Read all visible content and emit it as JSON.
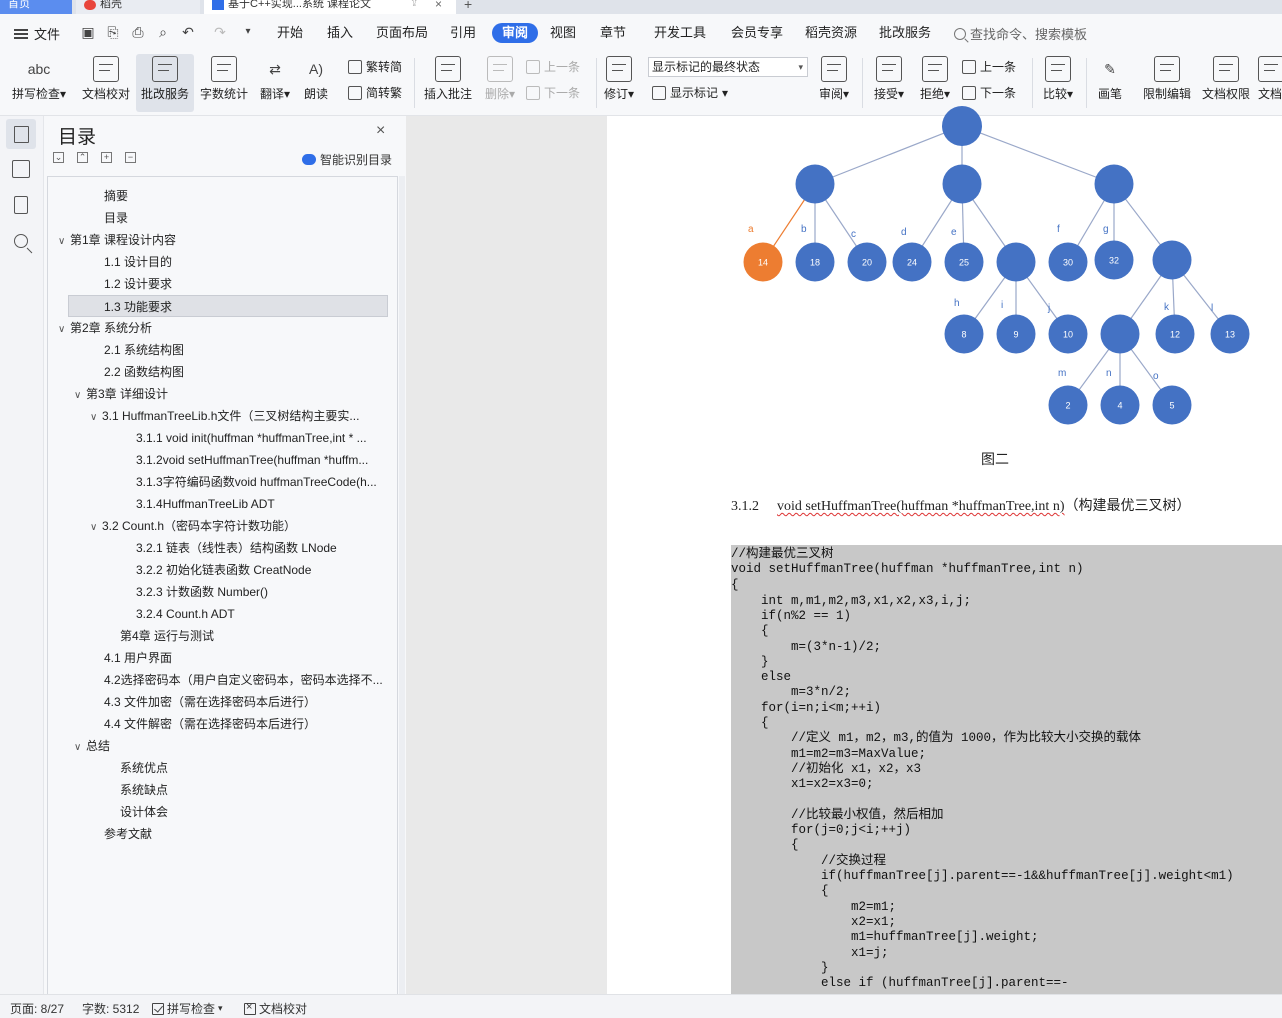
{
  "tabs": {
    "home": "首页",
    "daoke": "稻壳",
    "document": "基于C++实现...系统 课程论文"
  },
  "menu": {
    "file": "文件",
    "tabs": [
      "开始",
      "插入",
      "页面布局",
      "引用",
      "审阅",
      "视图",
      "章节",
      "开发工具",
      "会员专享",
      "稻壳资源",
      "批改服务"
    ],
    "active_tab": "审阅",
    "search_placeholder": "查找命令、搜索模板"
  },
  "ribbon": {
    "spell_check": "拼写检查",
    "doc_proof": "文档校对",
    "correct_service": "批改服务",
    "word_count": "字数统计",
    "translate": "翻译",
    "read_aloud": "朗读",
    "trad_to_simp": "繁转简",
    "simp_to_trad": "简转繁",
    "insert_comment": "插入批注",
    "delete": "删除",
    "prev_comment": "上一条",
    "next_comment": "下一条",
    "revise": "修订",
    "markup_combo": "显示标记的最终状态",
    "show_markup": "显示标记",
    "review": "审阅",
    "accept": "接受",
    "reject": "拒绝",
    "prev_change": "上一条",
    "next_change": "下一条",
    "compare": "比较",
    "pen": "画笔",
    "restrict_edit": "限制编辑",
    "doc_permission": "文档权限",
    "doc_more": "文档"
  },
  "toc": {
    "title": "目录",
    "smart_toc": "智能识别目录",
    "items": [
      {
        "label": "摘要",
        "level": 2,
        "chev": ""
      },
      {
        "label": "目录",
        "level": 2,
        "chev": ""
      },
      {
        "label": "第1章  课程设计内容",
        "level": 1,
        "chev": "∨"
      },
      {
        "label": "1.1 设计目的",
        "level": 2,
        "chev": ""
      },
      {
        "label": "1.2 设计要求",
        "level": 2,
        "chev": ""
      },
      {
        "label": "1.3 功能要求",
        "level": 2,
        "chev": "",
        "selected": true
      },
      {
        "label": "第2章  系统分析",
        "level": 1,
        "chev": "∨"
      },
      {
        "label": "2.1 系统结构图",
        "level": 2,
        "chev": ""
      },
      {
        "label": "2.2 函数结构图",
        "level": 2,
        "chev": ""
      },
      {
        "label": "第3章  详细设计",
        "level": 2,
        "chev": "∨"
      },
      {
        "label": "3.1 HuffmanTreeLib.h文件（三叉树结构主要实...",
        "level": 3,
        "chev": "∨"
      },
      {
        "label": "3.1.1 void init(huffman *huffmanTree,int * ...",
        "level": 4,
        "chev": ""
      },
      {
        "label": "3.1.2void setHuffmanTree(huffman *huffm...",
        "level": 4,
        "chev": ""
      },
      {
        "label": "3.1.3字符编码函数void huffmanTreeCode(h...",
        "level": 4,
        "chev": ""
      },
      {
        "label": "3.1.4HuffmanTreeLib ADT",
        "level": 4,
        "chev": ""
      },
      {
        "label": "3.2 Count.h（密码本字符计数功能）",
        "level": 3,
        "chev": "∨"
      },
      {
        "label": "3.2.1  链表（线性表）结构函数 LNode",
        "level": 4,
        "chev": ""
      },
      {
        "label": "3.2.2 初始化链表函数  CreatNode",
        "level": 4,
        "chev": ""
      },
      {
        "label": "3.2.3 计数函数  Number()",
        "level": 4,
        "chev": ""
      },
      {
        "label": "3.2.4 Count.h ADT",
        "level": 4,
        "chev": ""
      },
      {
        "label": "第4章  运行与测试",
        "level": 3,
        "chev": ""
      },
      {
        "label": "4.1 用户界面",
        "level": 2,
        "chev": ""
      },
      {
        "label": "4.2选择密码本（用户自定义密码本，密码本选择不...",
        "level": 2,
        "chev": ""
      },
      {
        "label": "4.3 文件加密（需在选择密码本后进行）",
        "level": 2,
        "chev": ""
      },
      {
        "label": "4.4 文件解密（需在选择密码本后进行）",
        "level": 2,
        "chev": ""
      },
      {
        "label": "总结",
        "level": 2,
        "chev": "∨"
      },
      {
        "label": "系统优点",
        "level": 3,
        "chev": ""
      },
      {
        "label": "系统缺点",
        "level": 3,
        "chev": ""
      },
      {
        "label": "设计体会",
        "level": 3,
        "chev": ""
      },
      {
        "label": "参考文献",
        "level": 2,
        "chev": ""
      }
    ]
  },
  "document": {
    "tree": {
      "colors": {
        "node": "#4472c4",
        "highlight": "#ed7d31",
        "edge": "#9aa8c9",
        "edge_highlight": "#ed7d31",
        "label": "#4472c4",
        "label_highlight": "#ed7d31"
      },
      "nodes": [
        {
          "id": "root",
          "text": ""
        },
        {
          "id": "n1",
          "text": ""
        },
        {
          "id": "n2",
          "text": ""
        },
        {
          "id": "n3",
          "text": ""
        },
        {
          "id": "a",
          "text": "14",
          "highlight": true
        },
        {
          "id": "b",
          "text": "18"
        },
        {
          "id": "c",
          "text": "20"
        },
        {
          "id": "d",
          "text": "24"
        },
        {
          "id": "e",
          "text": "25"
        },
        {
          "id": "n2c",
          "text": ""
        },
        {
          "id": "f",
          "text": "30"
        },
        {
          "id": "g",
          "text": "32"
        },
        {
          "id": "n3c",
          "text": ""
        },
        {
          "id": "h",
          "text": "8"
        },
        {
          "id": "i",
          "text": "9"
        },
        {
          "id": "j",
          "text": "10"
        },
        {
          "id": "n3cc",
          "text": ""
        },
        {
          "id": "k",
          "text": "12"
        },
        {
          "id": "l",
          "text": "13"
        },
        {
          "id": "m",
          "text": "2"
        },
        {
          "id": "n",
          "text": "4"
        },
        {
          "id": "o",
          "text": "5"
        }
      ],
      "edge_labels": [
        "a",
        "b",
        "c",
        "d",
        "e",
        "f",
        "g",
        "h",
        "i",
        "j",
        "k",
        "l",
        "m",
        "n",
        "o"
      ]
    },
    "caption": "图二",
    "heading": {
      "number": "3.1.2",
      "code": "void setHuffmanTree(huffman *huffmanTree,int n)",
      "suffix": "（构建最优三叉树）"
    },
    "code_lines": [
      "//构建最优三叉树",
      "void setHuffmanTree(huffman *huffmanTree,int n)",
      "{",
      "    int m,m1,m2,m3,x1,x2,x3,i,j;",
      "    if(n%2 == 1)",
      "    {",
      "        m=(3*n-1)/2;",
      "    }",
      "    else",
      "        m=3*n/2;",
      "    for(i=n;i<m;++i)",
      "    {",
      "        //定义 m1，m2，m3,的值为 1000，作为比较大小交换的载体",
      "        m1=m2=m3=MaxValue;",
      "        //初始化 x1，x2，x3",
      "        x1=x2=x3=0;",
      "",
      "        //比较最小权值，然后相加",
      "        for(j=0;j<i;++j)",
      "        {",
      "            //交换过程",
      "            if(huffmanTree[j].parent==-1&&huffmanTree[j].weight<m1)",
      "            {",
      "                m2=m1;",
      "                x2=x1;",
      "                m1=huffmanTree[j].weight;",
      "                x1=j;",
      "            }",
      "            else if (huffmanTree[j].parent==-"
    ]
  },
  "status": {
    "page": "页面: 8/27",
    "words": "字数: 5312",
    "spell": "拼写检查",
    "proof": "文档校对"
  }
}
